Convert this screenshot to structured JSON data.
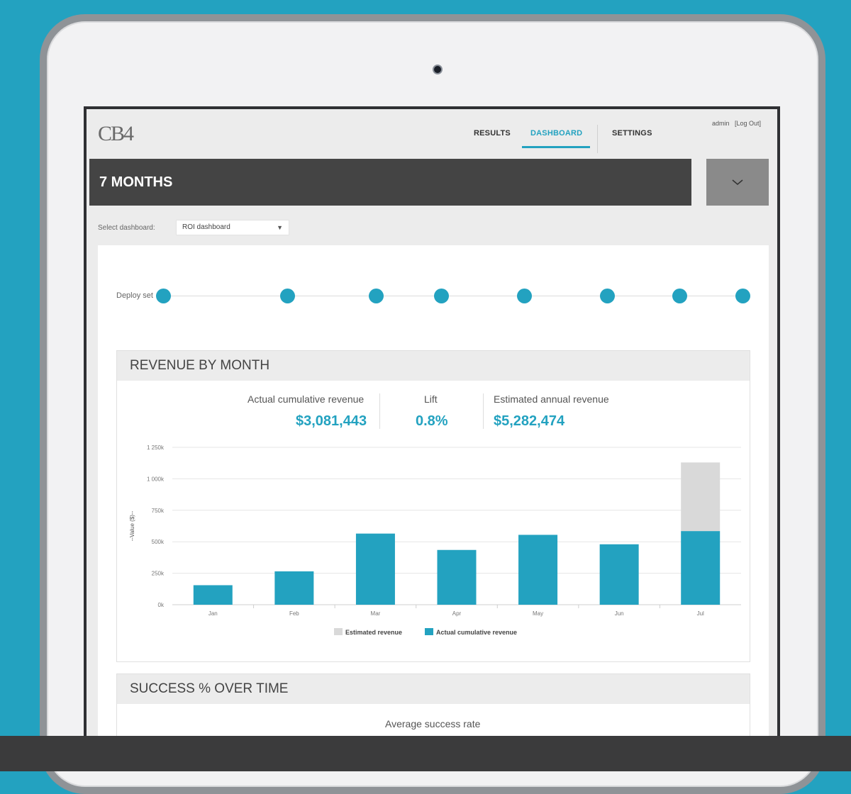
{
  "app": {
    "logo": "CB4",
    "nav": [
      {
        "label": "RESULTS",
        "active": false
      },
      {
        "label": "DASHBOARD",
        "active": true
      },
      {
        "label": "SETTINGS",
        "active": false
      }
    ],
    "user": {
      "name": "admin",
      "logout": "[Log Out]"
    }
  },
  "period": {
    "label": "7 MONTHS"
  },
  "dashboard_select": {
    "label": "Select dashboard:",
    "value": "ROI dashboard"
  },
  "deploy": {
    "label": "Deploy set",
    "count": 8
  },
  "revenue_panel": {
    "title": "REVENUE BY MONTH",
    "stats": [
      {
        "label": "Actual cumulative revenue",
        "value": "$3,081,443"
      },
      {
        "label": "Lift",
        "value": "0.8%"
      },
      {
        "label": "Estimated annual revenue",
        "value": "$5,282,474"
      }
    ]
  },
  "success_panel": {
    "title": "SUCCESS % OVER TIME",
    "stat_label": "Average success rate"
  },
  "colors": {
    "accent": "#23a2c0",
    "estimated": "#d9d9d9"
  },
  "chart_data": {
    "type": "bar",
    "stacked": true,
    "categories": [
      "Jan",
      "Feb",
      "Mar",
      "Apr",
      "May",
      "Jun",
      "Jul"
    ],
    "series": [
      {
        "name": "Actual cumulative revenue",
        "values": [
          155,
          265,
          565,
          435,
          555,
          480,
          585
        ]
      },
      {
        "name": "Estimated revenue",
        "values": [
          0,
          0,
          0,
          0,
          0,
          0,
          545
        ]
      }
    ],
    "ylabel": "--Value ($)--",
    "ylim": [
      0,
      1250
    ],
    "yticks": [
      "0k",
      "250k",
      "500k",
      "750k",
      "1 000k",
      "1 250k"
    ],
    "legend": "bottom",
    "grid": true
  }
}
